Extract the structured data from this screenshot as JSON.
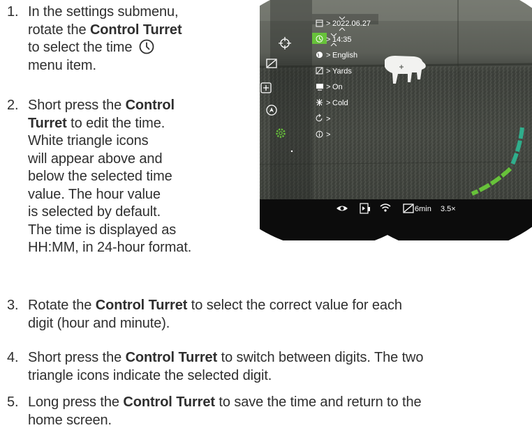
{
  "steps": [
    {
      "number": "1.",
      "lines": [
        [
          {
            "t": "In the settings submenu,"
          }
        ],
        [
          {
            "t": "rotate the "
          },
          {
            "t": "Control Turret",
            "b": true
          }
        ],
        [
          {
            "t": "to select the time "
          },
          {
            "icon": "clock-icon"
          }
        ],
        [
          {
            "t": "menu item."
          }
        ]
      ]
    },
    {
      "number": "2.",
      "lines": [
        [
          {
            "t": "Short press the "
          },
          {
            "t": "Control",
            "b": true
          }
        ],
        [
          {
            "t": "Turret",
            "b": true
          },
          {
            "t": " to edit the time."
          }
        ],
        [
          {
            "t": "White triangle icons"
          }
        ],
        [
          {
            "t": "will appear above and"
          }
        ],
        [
          {
            "t": "below the selected time"
          }
        ],
        [
          {
            "t": "value. The hour value"
          }
        ],
        [
          {
            "t": "is selected by default."
          }
        ],
        [
          {
            "t": "The time is displayed as"
          }
        ],
        [
          {
            "t": "HH:MM, in 24-hour format."
          }
        ]
      ]
    },
    {
      "number": "3.",
      "lines": [
        [
          {
            "t": "Rotate the "
          },
          {
            "t": "Control Turret",
            "b": true
          },
          {
            "t": " to select the correct value for each"
          }
        ],
        [
          {
            "t": "digit (hour and minute)."
          }
        ]
      ]
    },
    {
      "number": "4.",
      "lines": [
        [
          {
            "t": "Short press the "
          },
          {
            "t": "Control Turret",
            "b": true
          },
          {
            "t": " to switch between digits. The two"
          }
        ],
        [
          {
            "t": "triangle icons indicate the selected digit."
          }
        ]
      ]
    },
    {
      "number": "5.",
      "lines": [
        [
          {
            "t": "Long press the "
          },
          {
            "t": "Control Turret",
            "b": true
          },
          {
            "t": " to save the time and return to the"
          }
        ],
        [
          {
            "t": "home screen."
          }
        ]
      ]
    }
  ],
  "device_screen": {
    "menu_items": [
      {
        "icon": "calendar-icon",
        "value": "2022.06.27",
        "selected": false
      },
      {
        "icon": "clock-icon",
        "value": "14:35",
        "selected": true
      },
      {
        "icon": "globe-icon",
        "value": "English",
        "selected": false
      },
      {
        "icon": "units-icon",
        "value": "Yards",
        "selected": false
      },
      {
        "icon": "display-icon",
        "value": "On",
        "selected": false
      },
      {
        "icon": "cold-icon",
        "value": "Cold",
        "selected": false
      },
      {
        "icon": "reset-icon",
        "value": "",
        "selected": false
      },
      {
        "icon": "info-icon",
        "value": "",
        "selected": false
      }
    ],
    "side_icons": [
      "crosshair-icon",
      "calibration-icon",
      "zoom-box-icon",
      "compass-icon",
      "gear-icon"
    ],
    "status_bar": {
      "icons": [
        "eye-icon",
        "battery-icon",
        "wifi-icon",
        "calibration-icon"
      ],
      "calibration_timer": "6min",
      "zoom": "3.5×"
    },
    "accent_color": "#67c23a",
    "bar_color": "#2fae8c"
  }
}
